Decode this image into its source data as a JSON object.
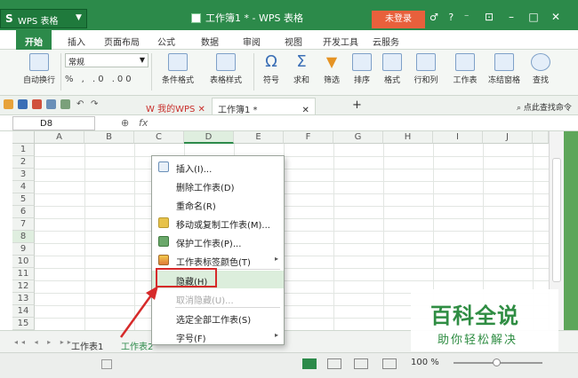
{
  "app": {
    "logo_mark": "S",
    "logo_text": "WPS 表格",
    "doc_title": "工作簿1 * - WPS 表格",
    "login_label": "未登录",
    "title_icons": "♂ ? ⁻"
  },
  "menu": [
    "开始",
    "插入",
    "页面布局",
    "公式",
    "数据",
    "审阅",
    "视图",
    "开发工具",
    "云服务"
  ],
  "ribbon": {
    "wrap_label": "自动换行",
    "number_format": "常规",
    "small_icons": "%  ,  .0  .00",
    "buttons": [
      "条件格式",
      "表格样式",
      "符号",
      "求和",
      "筛选",
      "排序",
      "格式",
      "行和列",
      "工作表",
      "冻结窗格",
      "查找"
    ]
  },
  "quickbar": {
    "tab_mywps": "我的WPS",
    "tab_doc": "工作簿1 *",
    "search_hint": "点此查找命令"
  },
  "formula": {
    "cell_ref": "D8",
    "fx": "fx"
  },
  "grid": {
    "columns": [
      "A",
      "B",
      "C",
      "D",
      "E",
      "F",
      "G",
      "H",
      "I",
      "J"
    ],
    "selected_column": "D",
    "rows": [
      "1",
      "2",
      "3",
      "4",
      "5",
      "6",
      "7",
      "8",
      "9",
      "10",
      "11",
      "12",
      "13",
      "14",
      "15"
    ],
    "selected_row": "8"
  },
  "context_menu": {
    "items": [
      {
        "label": "插入(I)...",
        "icon": "insert-icon",
        "disabled": false,
        "submenu": false
      },
      {
        "label": "删除工作表(D)",
        "icon": "",
        "disabled": false,
        "submenu": false
      },
      {
        "label": "重命名(R)",
        "icon": "",
        "disabled": false,
        "submenu": false
      },
      {
        "label": "移动或复制工作表(M)...",
        "icon": "move-copy-icon",
        "disabled": false,
        "submenu": false
      },
      {
        "label": "保护工作表(P)...",
        "icon": "protect-icon",
        "disabled": false,
        "submenu": false
      },
      {
        "label": "工作表标签颜色(T)",
        "icon": "tab-color-icon",
        "disabled": false,
        "submenu": true
      },
      {
        "label": "隐藏(H)",
        "icon": "",
        "disabled": false,
        "submenu": false
      },
      {
        "label": "取消隐藏(U)...",
        "icon": "",
        "disabled": true,
        "submenu": false
      },
      {
        "label": "选定全部工作表(S)",
        "icon": "",
        "disabled": false,
        "submenu": false
      },
      {
        "label": "字号(F)",
        "icon": "",
        "disabled": false,
        "submenu": true
      }
    ],
    "highlighted": "隐藏(H)"
  },
  "sheets": {
    "tabs": [
      "工作表1",
      "工作表2"
    ],
    "active": "工作表2"
  },
  "status": {
    "zoom": "100 %"
  },
  "watermark": {
    "title": "百科全说",
    "subtitle": "助你轻松解决"
  },
  "colors": {
    "accent": "#2c8a4a",
    "highlight_box": "#d62a2a",
    "login": "#e8603c"
  }
}
